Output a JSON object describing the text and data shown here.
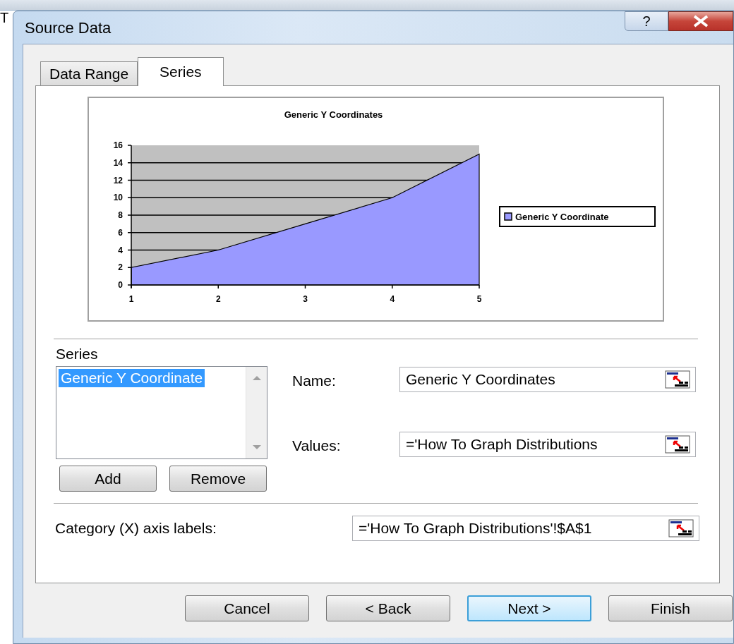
{
  "background_text": "T",
  "window": {
    "title": "Source Data",
    "help_glyph": "?"
  },
  "tabs": [
    {
      "label": "Data Range",
      "selected": false
    },
    {
      "label": "Series",
      "selected": true
    }
  ],
  "chart_preview": {
    "chart_data": {
      "type": "area",
      "title": "Generic Y Coordinates",
      "categories": [
        "1",
        "2",
        "3",
        "4",
        "5"
      ],
      "series": [
        {
          "name": "Generic Y Coordinate",
          "color": "#9999ff",
          "values": [
            2,
            4,
            7,
            10,
            15
          ]
        }
      ],
      "ylim": [
        0,
        16
      ],
      "grid": true,
      "yticks": [
        0,
        2,
        4,
        6,
        8,
        10,
        12,
        14,
        16
      ]
    }
  },
  "series_list": {
    "label": "Series",
    "items": [
      {
        "label": "Generic Y Coordinate",
        "selected": true
      }
    ]
  },
  "series_buttons": [
    "Add",
    "Remove"
  ],
  "fields": [
    {
      "label": "Name:",
      "value": "Generic Y Coordinates"
    },
    {
      "label": "Values:",
      "value": "='How To Graph Distributions"
    }
  ],
  "category_field": {
    "label": "Category (X) axis labels:",
    "value": "='How To Graph Distributions'!$A$1"
  },
  "buttons": [
    {
      "label": "Cancel",
      "default": false
    },
    {
      "label": "< Back",
      "default": false
    },
    {
      "label": "Next >",
      "default": true
    },
    {
      "label": "Finish",
      "default": false
    }
  ]
}
